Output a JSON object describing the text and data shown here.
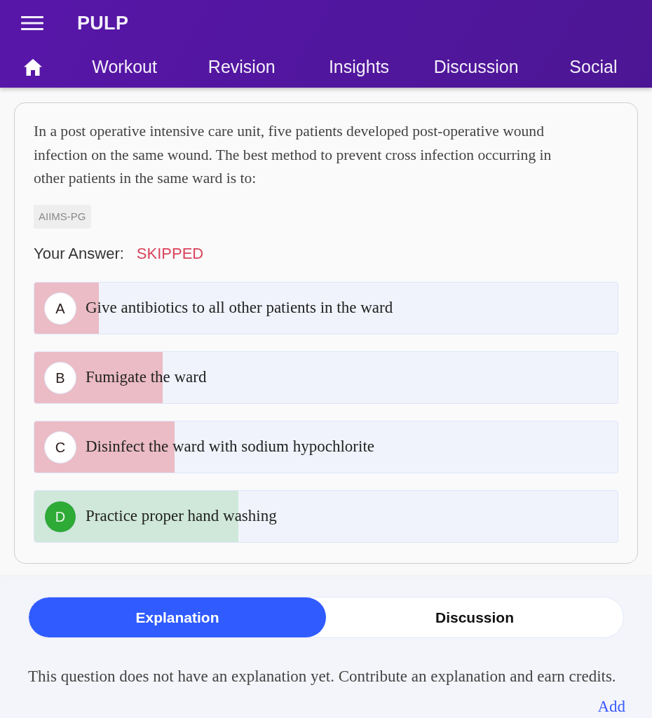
{
  "app_bar": {
    "title": "PULP",
    "tabs": [
      "Workout",
      "Revision",
      "Insights",
      "Discussion",
      "Social"
    ]
  },
  "question": {
    "text": "In a post operative intensive care unit, five patients developed post-operative wound infection on the same wound. The best method to prevent cross infection occurring in other patients in the same ward is to:",
    "tags": [
      "AIIMS-PG"
    ],
    "answer_label": "Your Answer:",
    "answer_value": "SKIPPED",
    "options": [
      {
        "letter": "A",
        "text": "Give antibiotics to all other patients in the ward",
        "level": 0.11,
        "correct": false
      },
      {
        "letter": "B",
        "text": "Fumigate the ward",
        "level": 0.22,
        "correct": false
      },
      {
        "letter": "C",
        "text": "Disinfect the ward with sodium hypochlorite",
        "level": 0.24,
        "correct": false
      },
      {
        "letter": "D",
        "text": "Practice proper hand washing",
        "level": 0.35,
        "correct": true
      }
    ]
  },
  "detail_tabs": [
    {
      "label": "Explanation",
      "selected": true
    },
    {
      "label": "Discussion",
      "selected": false
    }
  ],
  "explanation": {
    "text": "This question does not have an explanation yet. Contribute an explanation and earn credits.",
    "action": "Add"
  }
}
